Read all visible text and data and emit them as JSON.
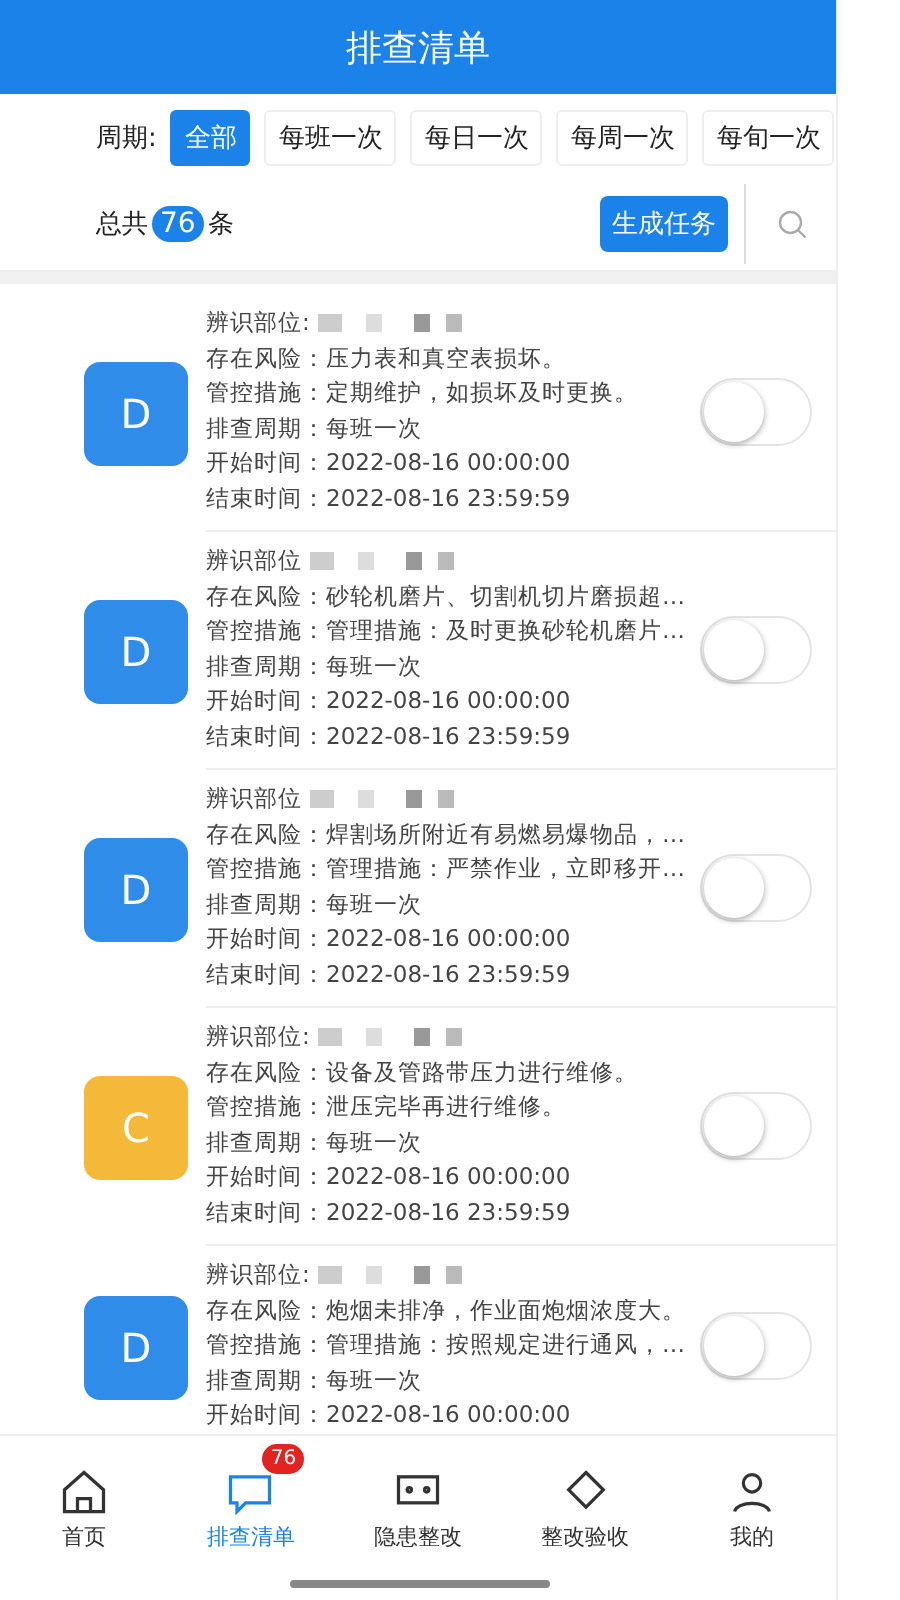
{
  "header": {
    "title": "排查清单"
  },
  "filter": {
    "label": "周期:",
    "options": [
      {
        "label": "全部",
        "selected": true
      },
      {
        "label": "每班一次",
        "selected": false
      },
      {
        "label": "每日一次",
        "selected": false
      },
      {
        "label": "每周一次",
        "selected": false
      },
      {
        "label": "每旬一次",
        "selected": false
      }
    ]
  },
  "summary": {
    "prefix": "总共",
    "count": "76",
    "suffix": "条",
    "action": "生成任务"
  },
  "items": [
    {
      "grade": "D",
      "color": "#2f8ce8",
      "on": false,
      "fields": [
        {
          "label": "辨识部位:"
        },
        {
          "label": "存在风险：",
          "value": "压力表和真空表损坏。"
        },
        {
          "label": "管控措施：",
          "value": "定期维护，如损坏及时更换。"
        },
        {
          "label": "排查周期：",
          "value": "每班一次"
        },
        {
          "label": "开始时间：",
          "value": "2022-08-16 00:00:00"
        },
        {
          "label": "结束时间：",
          "value": "2022-08-16 23:59:59"
        }
      ]
    },
    {
      "grade": "D",
      "color": "#2f8ce8",
      "on": false,
      "fields": [
        {
          "label": "辨识部位"
        },
        {
          "label": "存在风险：",
          "value": "砂轮机磨片、切割机切片磨损超…"
        },
        {
          "label": "管控措施：",
          "value": "管理措施：及时更换砂轮机磨片…"
        },
        {
          "label": "排查周期：",
          "value": "每班一次"
        },
        {
          "label": "开始时间：",
          "value": "2022-08-16 00:00:00"
        },
        {
          "label": "结束时间：",
          "value": "2022-08-16 23:59:59"
        }
      ]
    },
    {
      "grade": "D",
      "color": "#2f8ce8",
      "on": false,
      "fields": [
        {
          "label": "辨识部位"
        },
        {
          "label": "存在风险：",
          "value": "焊割场所附近有易燃易爆物品，…"
        },
        {
          "label": "管控措施：",
          "value": "管理措施：严禁作业，立即移开…"
        },
        {
          "label": "排查周期：",
          "value": "每班一次"
        },
        {
          "label": "开始时间：",
          "value": "2022-08-16 00:00:00"
        },
        {
          "label": "结束时间：",
          "value": "2022-08-16 23:59:59"
        }
      ]
    },
    {
      "grade": "C",
      "color": "#f5b93a",
      "on": false,
      "fields": [
        {
          "label": "辨识部位:"
        },
        {
          "label": "存在风险：",
          "value": "设备及管路带压力进行维修。"
        },
        {
          "label": "管控措施：",
          "value": "泄压完毕再进行维修。"
        },
        {
          "label": "排查周期：",
          "value": "每班一次"
        },
        {
          "label": "开始时间：",
          "value": "2022-08-16 00:00:00"
        },
        {
          "label": "结束时间：",
          "value": "2022-08-16 23:59:59"
        }
      ]
    },
    {
      "grade": "D",
      "color": "#2f8ce8",
      "on": false,
      "fields": [
        {
          "label": "辨识部位:"
        },
        {
          "label": "存在风险：",
          "value": "炮烟未排净，作业面炮烟浓度大。"
        },
        {
          "label": "管控措施：",
          "value": "管理措施：按照规定进行通风，…"
        },
        {
          "label": "排查周期：",
          "value": "每班一次"
        },
        {
          "label": "开始时间：",
          "value": "2022-08-16 00:00:00"
        }
      ]
    }
  ],
  "tabbar": [
    {
      "label": "首页",
      "kind": "home",
      "selected": false
    },
    {
      "label": "排查清单",
      "kind": "chat",
      "selected": true,
      "badge": "76"
    },
    {
      "label": "隐患整改",
      "kind": "screen",
      "selected": false
    },
    {
      "label": "整改验收",
      "kind": "check",
      "selected": false
    },
    {
      "label": "我的",
      "kind": "user",
      "selected": false
    }
  ]
}
